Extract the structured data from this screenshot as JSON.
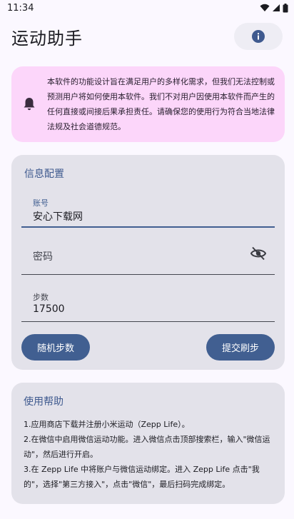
{
  "status_bar": {
    "time": "11:34"
  },
  "app_bar": {
    "title": "运动助手"
  },
  "warning": {
    "text": "本软件的功能设计旨在满足用户的多样化需求，但我们无法控制或预测用户将如何使用本软件。我们不对用户因使用本软件而产生的任何直接或间接后果承担责任。请确保您的使用行为符合当地法律法规及社会道德规范。"
  },
  "config": {
    "title": "信息配置",
    "account": {
      "label": "账号",
      "value": "安心下载网"
    },
    "password": {
      "label": "密码",
      "value": ""
    },
    "steps": {
      "label": "步数",
      "value": "17500"
    },
    "random_button": "随机步数",
    "submit_button": "提交刷步"
  },
  "help": {
    "title": "使用帮助",
    "items": [
      "1.应用商店下载并注册小米运动（Zepp Life）。",
      "2.在微信中启用微信运动功能。进入微信点击顶部搜索栏，输入\"微信运动\"，然后进行开启。",
      "3.在 Zepp Life 中将账户与微信运动绑定。进入 Zepp Life 点击\"我的\"，选择\"第三方接入\"，点击\"微信\"，最后扫码完成绑定。"
    ]
  },
  "colors": {
    "primary": "#415f91",
    "warning_bg": "#fcd6fa",
    "card_bg": "#e3e2ea",
    "background": "#fbf8ff"
  }
}
